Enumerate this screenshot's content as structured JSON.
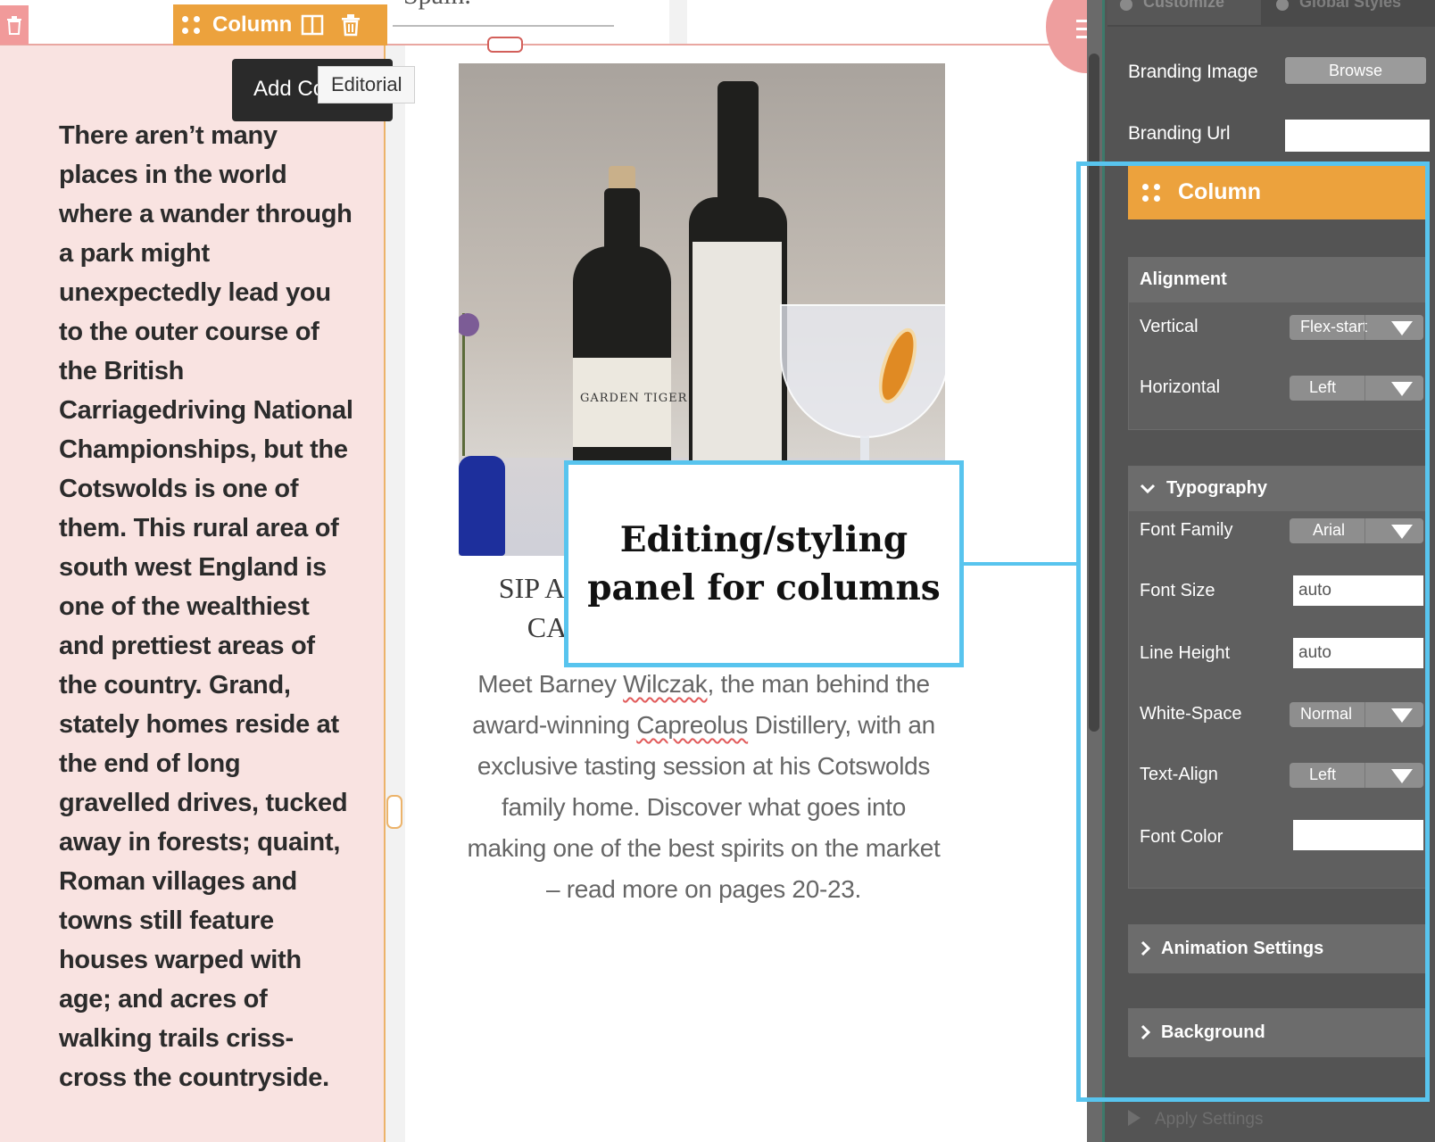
{
  "editor": {
    "column_toolbar_label": "Column",
    "tooltip_dark_text": "Add Co",
    "tooltip_light_text": "Editorial",
    "prev_text": "Spain.",
    "article_text": "There aren’t many places in the world where a wander through a park might unexpectedly lead you to the outer course of the British Carriagedriving National Championships, but the Cotswolds is one of them. This rural area of south west England is one of the wealthiest and prettiest areas of the country. Grand, stately homes reside at the end of long gravelled drives, tucked away in forests; quaint, Roman villages and towns still feature houses warped with age; and acres of walking trails criss-cross the countryside.",
    "product_title_line1": "SIP A",
    "product_title_line2": "CA",
    "product_desc_pre": "Meet Barney ",
    "product_desc_word1": "Wilczak",
    "product_desc_mid": ", the man behind the award-winning ",
    "product_desc_word2": "Capreolus",
    "product_desc_post": " Distillery, with an exclusive tasting session at his Cotswolds family home. Discover what goes into making one of the best spirits on the market – read more on pages 20-23.",
    "bottle_label_text": "GARDEN TIGER"
  },
  "callout": {
    "text": "Editing/styling panel for columns",
    "color": "#58c4ee"
  },
  "panel": {
    "tabs": [
      {
        "label": "Customize"
      },
      {
        "label": "Global Styles"
      }
    ],
    "branding_image_label": "Branding Image",
    "browse_label": "Browse",
    "branding_url_label": "Branding Url",
    "branding_url_value": "",
    "column_header": "Column",
    "alignment": {
      "title": "Alignment",
      "vertical_label": "Vertical",
      "vertical_value": "Flex-start",
      "horizontal_label": "Horizontal",
      "horizontal_value": "Left"
    },
    "typography": {
      "title": "Typography",
      "font_family_label": "Font Family",
      "font_family_value": "Arial",
      "font_size_label": "Font Size",
      "font_size_value": "auto",
      "line_height_label": "Line Height",
      "line_height_value": "auto",
      "white_space_label": "White-Space",
      "white_space_value": "Normal",
      "text_align_label": "Text-Align",
      "text_align_value": "Left",
      "font_color_label": "Font Color",
      "font_color_value": ""
    },
    "animation_title": "Animation Settings",
    "background_title": "Background",
    "apply_label": "Apply Settings"
  },
  "colors": {
    "accent_orange": "#eca23d",
    "column_bg": "#f9e3e1",
    "panel_bg": "#545454",
    "delete_red": "#f19a9a"
  },
  "icons": [
    "trash-icon",
    "drag-handle-icon",
    "columns-layout-icon",
    "menu-icon",
    "chevron-down-icon",
    "chevron-right-icon",
    "dropdown-arrow-icon",
    "play-icon"
  ]
}
